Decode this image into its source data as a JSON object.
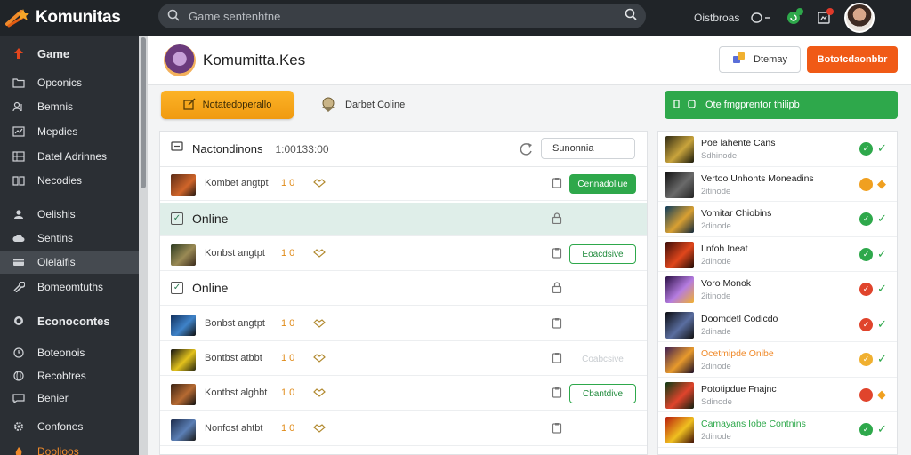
{
  "app": {
    "logo_text": "Komunitas",
    "logo_icon": "star-shooting-icon"
  },
  "search": {
    "placeholder": "Game sentenhtne"
  },
  "topbar": {
    "link_label": "Oistbroas",
    "icons": [
      "toggle-icon",
      "notification-icon",
      "bookmark-icon"
    ],
    "dot_colors": [
      "#2ea84b",
      "#e03a2a"
    ]
  },
  "sidebar": {
    "items": [
      {
        "label": "Game",
        "icon": "up-arrow-icon",
        "heading": true
      },
      {
        "label": "Opconics",
        "icon": "folder-icon"
      },
      {
        "label": "Bemnis",
        "icon": "users-icon"
      },
      {
        "label": "Mepdies",
        "icon": "chart-icon"
      },
      {
        "label": "Datel Adrinnes",
        "icon": "grid-icon"
      },
      {
        "label": "Necodies",
        "icon": "book-icon"
      },
      {
        "label": "Oelishis",
        "icon": "user-icon"
      },
      {
        "label": "Sentins",
        "icon": "cloud-icon"
      },
      {
        "label": "Olelaifis",
        "icon": "card-icon",
        "active": true
      },
      {
        "label": "Bomeomtuths",
        "icon": "wrench-icon"
      },
      {
        "label": "Econocontes",
        "icon": "coin-icon",
        "heading": true
      },
      {
        "label": "Boteonois",
        "icon": "clock-icon"
      },
      {
        "label": "Recobtres",
        "icon": "globe-icon"
      },
      {
        "label": "Benier",
        "icon": "chat-icon"
      },
      {
        "label": "Confones",
        "icon": "cog-icon"
      },
      {
        "label": "Doolioos",
        "icon": "flame-icon",
        "orange": true
      }
    ]
  },
  "profile": {
    "name": "Komumitta.Kes",
    "secondary_button": "Dtemay",
    "primary_button": "Bototcdaonbbr",
    "accent": "#f05a16"
  },
  "actions": {
    "yellow_button": "Notatedoperallo",
    "online_link": "Darbet Coline",
    "green_button": "Ote fmgprentor thilipb",
    "green": "#2ea84b"
  },
  "list": {
    "title": "Nactondinons",
    "timestamp": "1:00133:00",
    "filter_value": "Sunonnia",
    "rows": [
      {
        "kind": "item",
        "name": "Kombet angtpt",
        "nums": "1 0",
        "pill": "Cennadoliue",
        "pill_style": "solid"
      },
      {
        "kind": "section",
        "label": "Online",
        "highlight": true
      },
      {
        "kind": "item",
        "name": "Konbst angtpt",
        "nums": "1 0",
        "pill": "Eoacdsive",
        "pill_style": "ghost"
      },
      {
        "kind": "section",
        "label": "Online",
        "highlight": false
      },
      {
        "kind": "item",
        "name": "Bonbst angtpt",
        "nums": "1 0",
        "pill": "",
        "pill_style": "none"
      },
      {
        "kind": "item",
        "name": "Bontbst atbbt",
        "nums": "1 0",
        "pill": "Coabcsive",
        "pill_style": "faded"
      },
      {
        "kind": "item",
        "name": "Kontbst alghbt",
        "nums": "1 0",
        "pill": "Cbantdive",
        "pill_style": "ghost"
      },
      {
        "kind": "item",
        "name": "Nonfost ahtbt",
        "nums": "1 0",
        "pill": "",
        "pill_style": "none"
      }
    ]
  },
  "games": [
    {
      "title": "Poe lahente Cans",
      "sub": "Sdhinode",
      "status": "ok",
      "title_color": "default"
    },
    {
      "title": "Vertoo Unhonts Moneadins",
      "sub": "2itinode",
      "status": "warn",
      "title_color": "default"
    },
    {
      "title": "Vomitar Chiobins",
      "sub": "2dinode",
      "status": "ok",
      "title_color": "default"
    },
    {
      "title": "Lnfoh Ineat",
      "sub": "2dinode",
      "status": "ok",
      "title_color": "default"
    },
    {
      "title": "Voro Monok",
      "sub": "2itinode",
      "status": "bad",
      "title_color": "default"
    },
    {
      "title": "Doomdetl Codicdo",
      "sub": "2dinade",
      "status": "bad",
      "title_color": "default"
    },
    {
      "title": "Ocetmipde Onibe",
      "sub": "2dinode",
      "status": "mid",
      "title_color": "orange"
    },
    {
      "title": "Pototipdue Fnajnc",
      "sub": "Sdinode",
      "status": "bad2",
      "title_color": "default"
    },
    {
      "title": "Camayans Iobe Contnins",
      "sub": "2dinode",
      "status": "ok",
      "title_color": "mixed"
    }
  ],
  "status_colors": {
    "ok": "#2ea84b",
    "warn": "#f0a020",
    "bad": "#e0442c",
    "mid": "#f0b030"
  }
}
